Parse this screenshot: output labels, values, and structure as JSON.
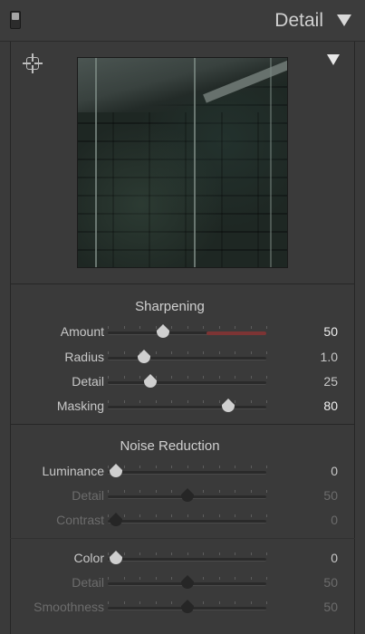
{
  "header": {
    "title": "Detail"
  },
  "sharpening": {
    "title": "Sharpening",
    "rows": [
      {
        "label": "Amount",
        "value": "50"
      },
      {
        "label": "Radius",
        "value": "1.0"
      },
      {
        "label": "Detail",
        "value": "25"
      },
      {
        "label": "Masking",
        "value": "80"
      }
    ]
  },
  "noise": {
    "title": "Noise Reduction",
    "rows": [
      {
        "label": "Luminance",
        "value": "0"
      },
      {
        "label": "Detail",
        "value": "50"
      },
      {
        "label": "Contrast",
        "value": "0"
      },
      {
        "label": "Color",
        "value": "0"
      },
      {
        "label": "Detail",
        "value": "50"
      },
      {
        "label": "Smoothness",
        "value": "50"
      }
    ]
  },
  "slider_levels": [
    0.35,
    0.23,
    0.27,
    0.76,
    0.05,
    0.5,
    0.05,
    0.05,
    0.5,
    0.5
  ],
  "colors": {
    "panel": "#3a3a3a",
    "accent_red": "#7c3434",
    "thumb": "#cfcfcf"
  }
}
